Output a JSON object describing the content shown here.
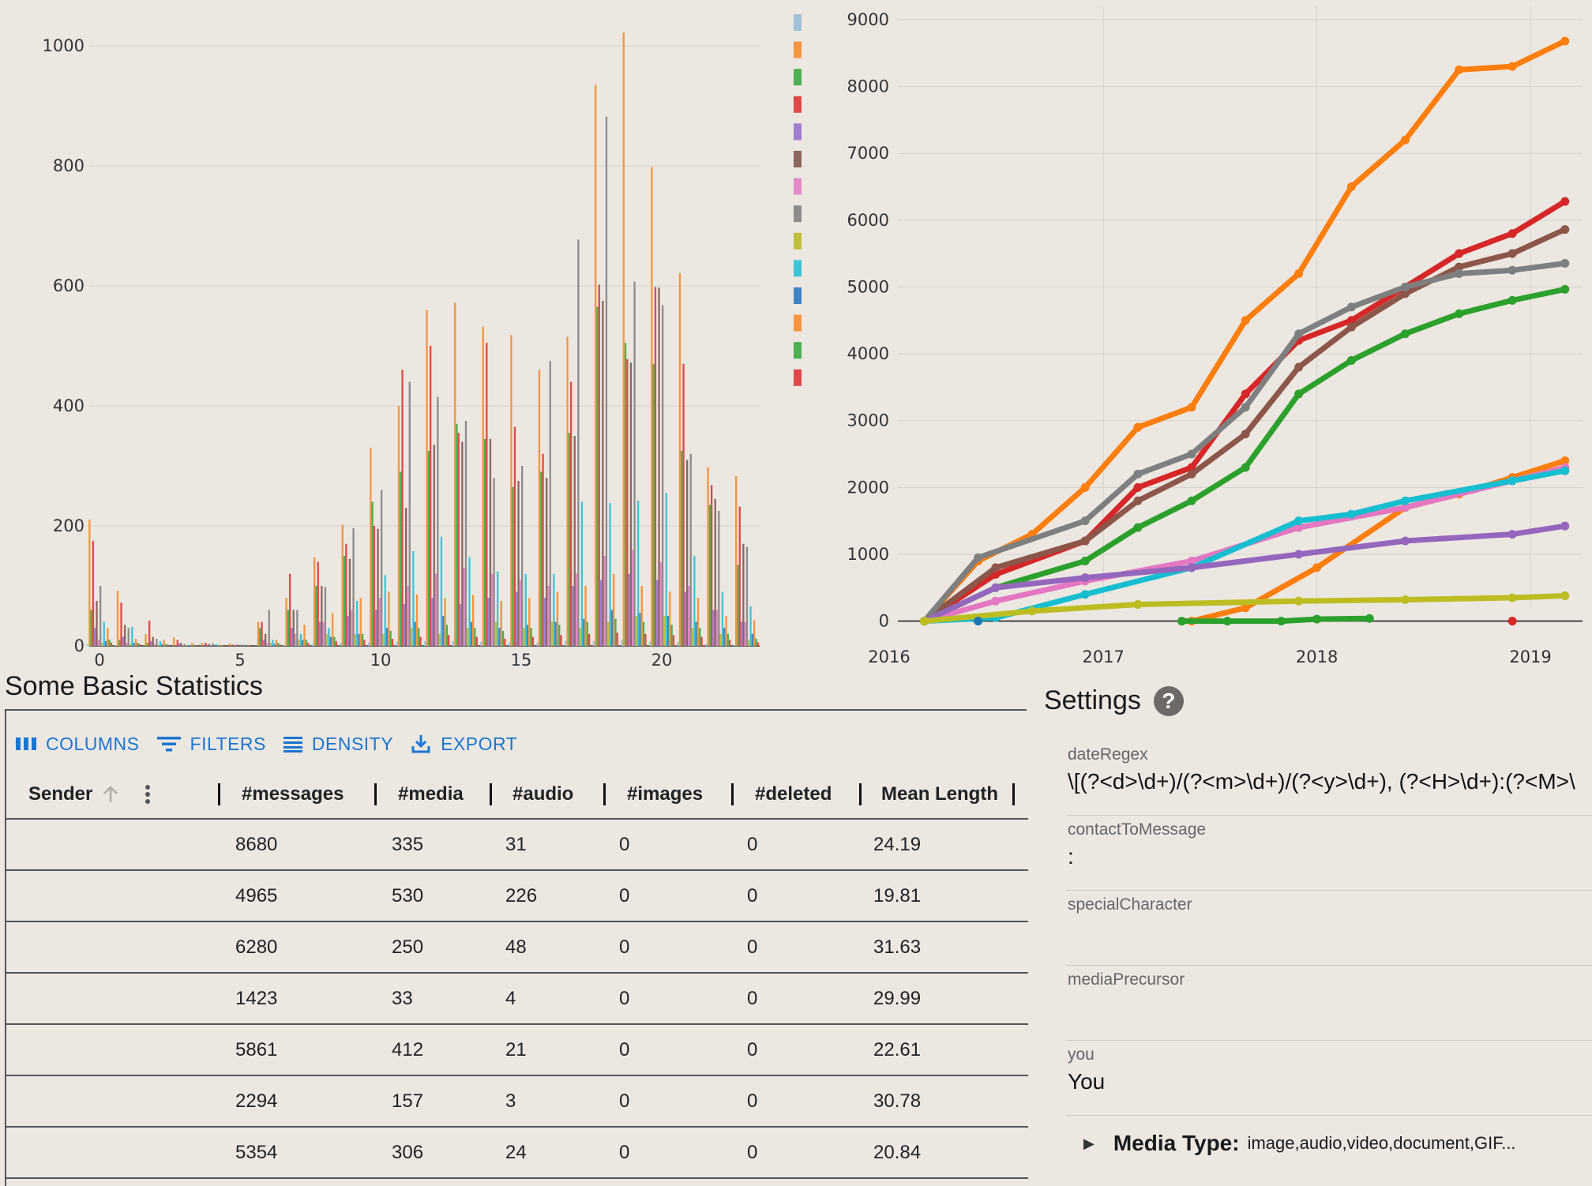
{
  "chart_data": [
    {
      "type": "bar",
      "title": "",
      "xlabel": "",
      "ylabel": "",
      "x": [
        0,
        1,
        2,
        3,
        4,
        5,
        6,
        7,
        8,
        9,
        10,
        11,
        12,
        13,
        14,
        15,
        16,
        17,
        18,
        19,
        20,
        21,
        22,
        23
      ],
      "xticks": [
        0,
        5,
        10,
        15,
        20
      ],
      "ylim": [
        0,
        1050
      ],
      "yticks": [
        0,
        200,
        400,
        600,
        800,
        1000
      ],
      "grid": true,
      "legend_placement": "right",
      "series": [
        {
          "color": "#9ec3d9",
          "values": [
            3,
            1,
            0,
            0,
            0,
            0,
            0,
            2,
            3,
            5,
            6,
            7,
            8,
            8,
            7,
            6,
            6,
            9,
            8,
            10,
            7,
            7,
            4,
            2
          ]
        },
        {
          "color": "#f4953f",
          "values": [
            210,
            92,
            20,
            14,
            5,
            4,
            40,
            80,
            148,
            202,
            330,
            400,
            560,
            572,
            532,
            518,
            460,
            515,
            935,
            1022,
            798,
            621,
            298,
            283
          ]
        },
        {
          "color": "#4caf50",
          "values": [
            60,
            10,
            5,
            0,
            0,
            0,
            30,
            60,
            100,
            150,
            240,
            290,
            325,
            370,
            345,
            265,
            290,
            355,
            565,
            505,
            470,
            325,
            235,
            135
          ]
        },
        {
          "color": "#e04848",
          "values": [
            175,
            72,
            42,
            10,
            5,
            2,
            40,
            120,
            140,
            170,
            200,
            460,
            500,
            355,
            505,
            365,
            320,
            440,
            602,
            478,
            598,
            470,
            268,
            232
          ]
        },
        {
          "color": "#a07dcf",
          "values": [
            30,
            15,
            8,
            4,
            2,
            1,
            10,
            30,
            40,
            50,
            60,
            70,
            80,
            70,
            80,
            90,
            80,
            100,
            110,
            120,
            110,
            90,
            60,
            40
          ]
        },
        {
          "color": "#8c6560",
          "values": [
            75,
            35,
            15,
            5,
            3,
            2,
            20,
            60,
            100,
            145,
            195,
            230,
            335,
            340,
            345,
            275,
            280,
            350,
            575,
            472,
            597,
            310,
            245,
            170
          ]
        },
        {
          "color": "#e389c8",
          "values": [
            10,
            5,
            3,
            1,
            1,
            0,
            5,
            20,
            40,
            60,
            80,
            100,
            120,
            130,
            120,
            110,
            100,
            120,
            150,
            160,
            140,
            100,
            60,
            40
          ]
        },
        {
          "color": "#8e8b8b",
          "values": [
            100,
            30,
            12,
            3,
            4,
            2,
            60,
            60,
            98,
            196,
            260,
            440,
            415,
            375,
            280,
            300,
            475,
            677,
            882,
            607,
            568,
            320,
            225,
            165
          ]
        },
        {
          "color": "#bfc13a",
          "values": [
            5,
            3,
            2,
            1,
            0,
            0,
            5,
            10,
            20,
            20,
            20,
            30,
            20,
            30,
            40,
            30,
            40,
            30,
            40,
            50,
            50,
            30,
            20,
            10
          ]
        },
        {
          "color": "#3cc4d8",
          "values": [
            40,
            32,
            8,
            2,
            3,
            2,
            10,
            20,
            30,
            75,
            118,
            158,
            182,
            148,
            124,
            120,
            120,
            240,
            238,
            242,
            255,
            150,
            90,
            66
          ]
        },
        {
          "color": "#3f84c4",
          "values": [
            8,
            5,
            3,
            1,
            1,
            0,
            3,
            10,
            15,
            20,
            30,
            40,
            50,
            40,
            30,
            35,
            40,
            45,
            60,
            55,
            50,
            40,
            30,
            20
          ]
        },
        {
          "color": "#f7943d",
          "values": [
            30,
            12,
            10,
            5,
            2,
            2,
            10,
            35,
            55,
            80,
            90,
            86,
            80,
            85,
            75,
            80,
            90,
            100,
            120,
            100,
            90,
            80,
            50,
            43
          ]
        },
        {
          "color": "#4caf50",
          "values": [
            10,
            5,
            3,
            2,
            1,
            0,
            5,
            10,
            15,
            20,
            25,
            30,
            35,
            30,
            25,
            30,
            35,
            40,
            45,
            40,
            35,
            30,
            20,
            12
          ]
        },
        {
          "color": "#e04848",
          "values": [
            5,
            3,
            2,
            1,
            0,
            0,
            2,
            5,
            8,
            10,
            12,
            15,
            18,
            15,
            12,
            15,
            18,
            20,
            22,
            20,
            18,
            15,
            10,
            6
          ]
        }
      ]
    },
    {
      "type": "line",
      "title": "",
      "xlabel": "",
      "ylabel": "",
      "xticks": [
        "2016",
        "2017",
        "2018",
        "2019"
      ],
      "xlim": [
        "2016-01-01",
        "2019-03-31"
      ],
      "ylim": [
        -300,
        9200
      ],
      "yticks": [
        0,
        1000,
        2000,
        3000,
        4000,
        5000,
        6000,
        7000,
        8000,
        9000
      ],
      "grid": true,
      "series": [
        {
          "color": "#ff7f0e",
          "points": [
            [
              "2016-03-01",
              0
            ],
            [
              "2016-06-01",
              900
            ],
            [
              "2016-09-01",
              1300
            ],
            [
              "2016-12-01",
              2000
            ],
            [
              "2017-03-01",
              2900
            ],
            [
              "2017-06-01",
              3200
            ],
            [
              "2017-09-01",
              4500
            ],
            [
              "2017-12-01",
              5200
            ],
            [
              "2018-03-01",
              6500
            ],
            [
              "2018-06-01",
              7200
            ],
            [
              "2018-09-01",
              8250
            ],
            [
              "2018-12-01",
              8300
            ],
            [
              "2019-03-01",
              8680
            ]
          ]
        },
        {
          "color": "#d62728",
          "points": [
            [
              "2016-03-01",
              0
            ],
            [
              "2016-07-01",
              700
            ],
            [
              "2016-12-01",
              1200
            ],
            [
              "2017-03-01",
              2000
            ],
            [
              "2017-06-01",
              2300
            ],
            [
              "2017-09-01",
              3400
            ],
            [
              "2017-12-01",
              4200
            ],
            [
              "2018-03-01",
              4500
            ],
            [
              "2018-06-01",
              5000
            ],
            [
              "2018-09-01",
              5500
            ],
            [
              "2018-12-01",
              5800
            ],
            [
              "2019-03-01",
              6280
            ]
          ]
        },
        {
          "color": "#8c564b",
          "points": [
            [
              "2016-03-01",
              0
            ],
            [
              "2016-07-01",
              800
            ],
            [
              "2016-12-01",
              1200
            ],
            [
              "2017-03-01",
              1800
            ],
            [
              "2017-06-01",
              2200
            ],
            [
              "2017-09-01",
              2800
            ],
            [
              "2017-12-01",
              3800
            ],
            [
              "2018-03-01",
              4400
            ],
            [
              "2018-06-01",
              4900
            ],
            [
              "2018-09-01",
              5300
            ],
            [
              "2018-12-01",
              5500
            ],
            [
              "2019-03-01",
              5861
            ]
          ]
        },
        {
          "color": "#7f7f7f",
          "points": [
            [
              "2016-03-01",
              0
            ],
            [
              "2016-06-01",
              950
            ],
            [
              "2016-12-01",
              1500
            ],
            [
              "2017-03-01",
              2200
            ],
            [
              "2017-06-01",
              2500
            ],
            [
              "2017-09-01",
              3200
            ],
            [
              "2017-12-01",
              4300
            ],
            [
              "2018-03-01",
              4700
            ],
            [
              "2018-06-01",
              5000
            ],
            [
              "2018-09-01",
              5200
            ],
            [
              "2018-12-01",
              5250
            ],
            [
              "2019-03-01",
              5354
            ]
          ]
        },
        {
          "color": "#2ca02c",
          "points": [
            [
              "2016-03-01",
              0
            ],
            [
              "2016-07-01",
              500
            ],
            [
              "2016-12-01",
              900
            ],
            [
              "2017-03-01",
              1400
            ],
            [
              "2017-06-01",
              1800
            ],
            [
              "2017-09-01",
              2300
            ],
            [
              "2017-12-01",
              3400
            ],
            [
              "2018-03-01",
              3900
            ],
            [
              "2018-06-01",
              4300
            ],
            [
              "2018-09-01",
              4600
            ],
            [
              "2018-12-01",
              4800
            ],
            [
              "2019-03-01",
              4965
            ]
          ]
        },
        {
          "color": "#ff7f0e",
          "points": [
            [
              "2017-06-01",
              0
            ],
            [
              "2017-09-01",
              200
            ],
            [
              "2018-01-01",
              800
            ],
            [
              "2018-06-01",
              1700
            ],
            [
              "2018-09-01",
              1900
            ],
            [
              "2018-12-01",
              2150
            ],
            [
              "2019-03-01",
              2400
            ]
          ]
        },
        {
          "color": "#e377c2",
          "points": [
            [
              "2016-03-01",
              0
            ],
            [
              "2016-07-01",
              300
            ],
            [
              "2016-12-01",
              600
            ],
            [
              "2017-06-01",
              900
            ],
            [
              "2017-12-01",
              1400
            ],
            [
              "2018-06-01",
              1700
            ],
            [
              "2018-12-01",
              2100
            ],
            [
              "2019-03-01",
              2300
            ]
          ]
        },
        {
          "color": "#17becf",
          "points": [
            [
              "2016-03-01",
              0
            ],
            [
              "2016-07-01",
              50
            ],
            [
              "2016-12-01",
              400
            ],
            [
              "2017-06-01",
              800
            ],
            [
              "2017-12-01",
              1500
            ],
            [
              "2018-03-01",
              1600
            ],
            [
              "2018-06-01",
              1800
            ],
            [
              "2018-12-01",
              2100
            ],
            [
              "2019-03-01",
              2250
            ]
          ]
        },
        {
          "color": "#9467bd",
          "points": [
            [
              "2016-03-01",
              0
            ],
            [
              "2016-07-01",
              500
            ],
            [
              "2016-12-01",
              650
            ],
            [
              "2017-06-01",
              800
            ],
            [
              "2017-12-01",
              1000
            ],
            [
              "2018-06-01",
              1200
            ],
            [
              "2018-12-01",
              1300
            ],
            [
              "2019-03-01",
              1423
            ]
          ]
        },
        {
          "color": "#bcbd22",
          "points": [
            [
              "2016-03-01",
              0
            ],
            [
              "2016-09-01",
              150
            ],
            [
              "2017-03-01",
              250
            ],
            [
              "2017-12-01",
              300
            ],
            [
              "2018-06-01",
              320
            ],
            [
              "2018-12-01",
              350
            ],
            [
              "2019-03-01",
              380
            ]
          ]
        },
        {
          "color": "#2ca02c",
          "points": [
            [
              "2017-05-15",
              0
            ],
            [
              "2017-08-01",
              0
            ],
            [
              "2017-11-01",
              0
            ],
            [
              "2018-01-01",
              30
            ],
            [
              "2018-04-01",
              40
            ]
          ]
        },
        {
          "color": "#1f77b4",
          "points": [
            [
              "2016-06-01",
              0
            ]
          ]
        },
        {
          "color": "#d62728",
          "points": [
            [
              "2018-12-01",
              0
            ]
          ]
        }
      ]
    }
  ],
  "stats": {
    "title": "Some Basic Statistics",
    "toolbar": {
      "columns": "COLUMNS",
      "filters": "FILTERS",
      "density": "DENSITY",
      "export": "EXPORT"
    },
    "headers": {
      "sender": "Sender",
      "messages": "#messages",
      "media": "#media",
      "audio": "#audio",
      "images": "#images",
      "deleted": "#deleted",
      "mean_length": "Mean Length"
    },
    "rows": [
      {
        "sender": "",
        "messages": "8680",
        "media": "335",
        "audio": "31",
        "images": "0",
        "deleted": "0",
        "mean_length": "24.19"
      },
      {
        "sender": "",
        "messages": "4965",
        "media": "530",
        "audio": "226",
        "images": "0",
        "deleted": "0",
        "mean_length": "19.81"
      },
      {
        "sender": "",
        "messages": "6280",
        "media": "250",
        "audio": "48",
        "images": "0",
        "deleted": "0",
        "mean_length": "31.63"
      },
      {
        "sender": "",
        "messages": "1423",
        "media": "33",
        "audio": "4",
        "images": "0",
        "deleted": "0",
        "mean_length": "29.99"
      },
      {
        "sender": "",
        "messages": "5861",
        "media": "412",
        "audio": "21",
        "images": "0",
        "deleted": "0",
        "mean_length": "22.61"
      },
      {
        "sender": "",
        "messages": "2294",
        "media": "157",
        "audio": "3",
        "images": "0",
        "deleted": "0",
        "mean_length": "30.78"
      },
      {
        "sender": "",
        "messages": "5354",
        "media": "306",
        "audio": "24",
        "images": "0",
        "deleted": "0",
        "mean_length": "20.84"
      }
    ]
  },
  "settings": {
    "title": "Settings",
    "help_icon": "?",
    "fields": {
      "dateRegex": {
        "label": "dateRegex",
        "value": "\\[(?<d>\\d+)/(?<m>\\d+)/(?<y>\\d+), (?<H>\\d+):(?<M>\\"
      },
      "contactToMessage": {
        "label": "contactToMessage",
        "value": ":"
      },
      "specialCharacter": {
        "label": "specialCharacter",
        "value": ""
      },
      "mediaPrecursor": {
        "label": "mediaPrecursor",
        "value": ""
      },
      "you": {
        "label": "you",
        "value": "You"
      }
    },
    "media_type": {
      "label": "Media Type:",
      "value": "image,audio,video,document,GIF..."
    }
  }
}
